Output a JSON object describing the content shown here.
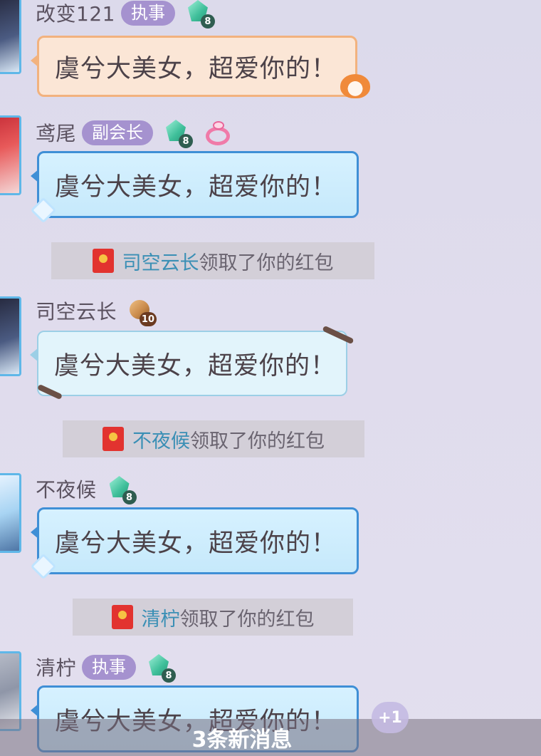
{
  "messages": [
    {
      "username": "改变121",
      "role": "执事",
      "gem_level": "8",
      "text": "虞兮大美女，超爱你的！"
    },
    {
      "username": "鸢尾",
      "role": "副会长",
      "gem_level": "8",
      "text": "虞兮大美女，超爱你的！"
    },
    {
      "username": "司空云长",
      "gem_level": "10",
      "text": "虞兮大美女，超爱你的！"
    },
    {
      "username": "不夜候",
      "gem_level": "8",
      "text": "虞兮大美女，超爱你的！"
    },
    {
      "username": "清柠",
      "role": "执事",
      "gem_level": "8",
      "text": "虞兮大美女，超爱你的！"
    }
  ],
  "notices": [
    {
      "who": "司空云长",
      "rest": "领取了你的红包"
    },
    {
      "who": "不夜候",
      "rest": "领取了你的红包"
    },
    {
      "who": "清柠",
      "rest": "领取了你的红包"
    }
  ],
  "new_messages": {
    "label": "3条新消息",
    "badge": "+1"
  }
}
